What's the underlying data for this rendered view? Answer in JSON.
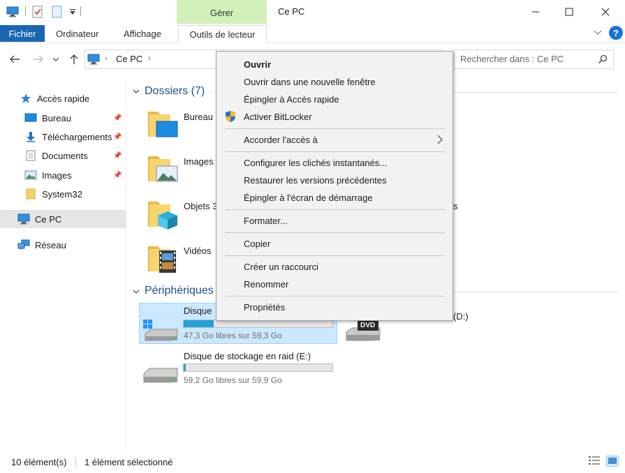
{
  "window": {
    "title": "Ce PC"
  },
  "ribbon": {
    "contextual_group": "Gérer",
    "tabs": {
      "file": "Fichier",
      "computer": "Ordinateur",
      "view": "Affichage",
      "drive_tools": "Outils de lecteur"
    }
  },
  "address": {
    "path": "Ce PC"
  },
  "search": {
    "placeholder": "Rechercher dans : Ce PC"
  },
  "nav": {
    "quick_access": "Accès rapide",
    "desktop": "Bureau",
    "downloads": "Téléchargements",
    "documents": "Documents",
    "pictures": "Images",
    "system32": "System32",
    "this_pc": "Ce PC",
    "network": "Réseau"
  },
  "content": {
    "folders_header": "Dossiers (7)",
    "folders": [
      "Bureau",
      "Images",
      "Objets 3",
      "Vidéos"
    ],
    "folder_partial_right": "s",
    "devices_header": "Périphériques",
    "drive_c": {
      "label": "Disque",
      "free": "47,3 Go libres sur 59,3 Go",
      "used_fraction": 0.2
    },
    "drive_d": {
      "label": "(D:)",
      "badge": "DVD"
    },
    "drive_e": {
      "label": "Disque de stockage en raid (E:)",
      "free": "59,2 Go libres sur 59,9 Go",
      "used_fraction": 0.012
    }
  },
  "context_menu": {
    "open": "Ouvrir",
    "open_new_window": "Ouvrir dans une nouvelle fenêtre",
    "pin_quick_access": "Épingler à Accès rapide",
    "bitlocker": "Activer BitLocker",
    "give_access": "Accorder l'accès à",
    "shadow_copies": "Configurer les clichés instantanés...",
    "restore_versions": "Restaurer les versions précédentes",
    "pin_start": "Épingler à l'écran de démarrage",
    "format": "Formater...",
    "copy": "Copier",
    "create_shortcut": "Créer un raccourci",
    "rename": "Renommer",
    "properties": "Propriétés"
  },
  "status": {
    "items": "10 élément(s)",
    "selected": "1 élément sélectionné"
  }
}
